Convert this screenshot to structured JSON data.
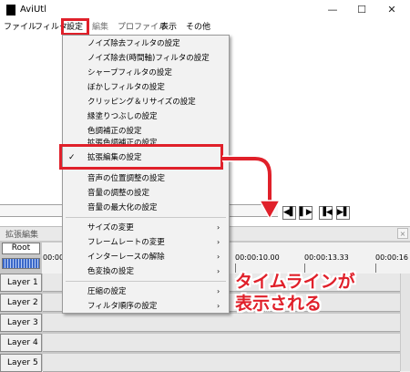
{
  "window": {
    "title": "AviUtl",
    "controls": {
      "minimize": "—",
      "maximize": "☐",
      "close": "✕"
    }
  },
  "menubar": {
    "items": [
      "ファイル",
      "フィルタ",
      "設定",
      "編集",
      "プロファイル",
      "表示",
      "その他"
    ]
  },
  "settings_menu": {
    "items": [
      "ノイズ除去フィルタの設定",
      "ノイズ除去(時間軸)フィルタの設定",
      "シャープフィルタの設定",
      "ぼかしフィルタの設定",
      "クリッピング＆リサイズの設定",
      "縁塗りつぶしの設定",
      "色調補正の設定",
      "拡張色調補正の設定",
      "拡張編集の設定",
      "音声の位置調整の設定",
      "音量の調整の設定",
      "音量の最大化の設定",
      "サイズの変更",
      "フレームレートの変更",
      "インターレースの解除",
      "色変換の設定",
      "圧縮の設定",
      "フィルタ順序の設定"
    ],
    "checkmark": "✓",
    "submenu_arrow": "›"
  },
  "playback_controls": [
    "◀▌",
    "▌▶",
    "▐◀",
    "▶▌"
  ],
  "timeline": {
    "title": "拡張編集",
    "close": "×",
    "root_label": "Root",
    "timestamps": [
      "00:00:0",
      "00:00:10.00",
      "00:00:13.33",
      "00:00:16"
    ],
    "layers": [
      "Layer 1",
      "Layer 2",
      "Layer 3",
      "Layer 4",
      "Layer 5"
    ]
  },
  "annotation": {
    "line1": "タイムラインが",
    "line2": "表示される",
    "color": "#e0202a"
  }
}
